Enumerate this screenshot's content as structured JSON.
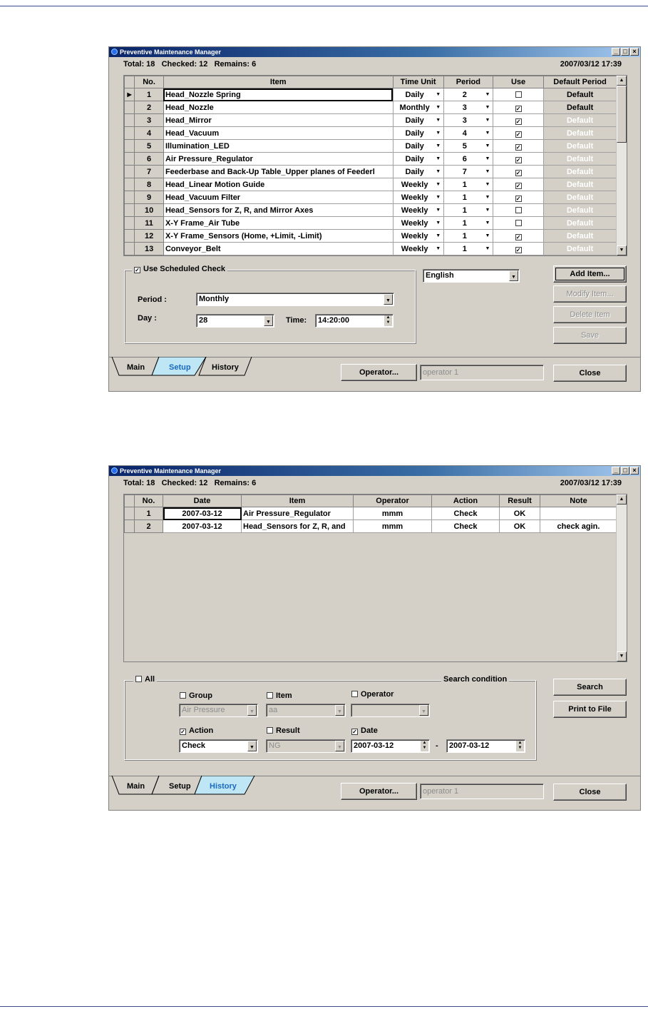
{
  "window_title": "Preventive Maintenance Manager",
  "setup": {
    "info": {
      "total": "Total: 18",
      "checked": "Checked: 12",
      "remains": "Remains: 6",
      "datetime": "2007/03/12 17:39"
    },
    "columns": [
      "No.",
      "Item",
      "Time Unit",
      "Period",
      "Use",
      "Default Period"
    ],
    "rows": [
      {
        "no": "1",
        "item": "Head_Nozzle Spring",
        "unit": "Daily",
        "period": "2",
        "use": false,
        "default": "Default",
        "default_enabled": true,
        "current": true
      },
      {
        "no": "2",
        "item": "Head_Nozzle",
        "unit": "Monthly",
        "period": "3",
        "use": true,
        "default": "Default",
        "default_enabled": true
      },
      {
        "no": "3",
        "item": "Head_Mirror",
        "unit": "Daily",
        "period": "3",
        "use": true,
        "default": "Default",
        "default_enabled": false
      },
      {
        "no": "4",
        "item": "Head_Vacuum",
        "unit": "Daily",
        "period": "4",
        "use": true,
        "default": "Default",
        "default_enabled": false
      },
      {
        "no": "5",
        "item": "Illumination_LED",
        "unit": "Daily",
        "period": "5",
        "use": true,
        "default": "Default",
        "default_enabled": false
      },
      {
        "no": "6",
        "item": "Air Pressure_Regulator",
        "unit": "Daily",
        "period": "6",
        "use": true,
        "default": "Default",
        "default_enabled": false
      },
      {
        "no": "7",
        "item": "Feederbase and Back-Up Table_Upper planes of Feederl",
        "unit": "Daily",
        "period": "7",
        "use": true,
        "default": "Default",
        "default_enabled": false
      },
      {
        "no": "8",
        "item": "Head_Linear Motion Guide",
        "unit": "Weekly",
        "period": "1",
        "use": true,
        "default": "Default",
        "default_enabled": false
      },
      {
        "no": "9",
        "item": "Head_Vacuum Filter",
        "unit": "Weekly",
        "period": "1",
        "use": true,
        "default": "Default",
        "default_enabled": false
      },
      {
        "no": "10",
        "item": "Head_Sensors for Z, R, and Mirror Axes",
        "unit": "Weekly",
        "period": "1",
        "use": false,
        "default": "Default",
        "default_enabled": false
      },
      {
        "no": "11",
        "item": "X-Y Frame_Air Tube",
        "unit": "Weekly",
        "period": "1",
        "use": false,
        "default": "Default",
        "default_enabled": false
      },
      {
        "no": "12",
        "item": "X-Y Frame_Sensors (Home, +Limit, -Limit)",
        "unit": "Weekly",
        "period": "1",
        "use": true,
        "default": "Default",
        "default_enabled": false
      },
      {
        "no": "13",
        "item": "Conveyor_Belt",
        "unit": "Weekly",
        "period": "1",
        "use": true,
        "default": "Default",
        "default_enabled": false
      }
    ],
    "schedule": {
      "label": "Use Scheduled Check",
      "checked": true,
      "period_label": "Period :",
      "period_value": "Monthly",
      "day_label": "Day :",
      "day_value": "28",
      "time_label": "Time:",
      "time_value": "14:20:00"
    },
    "language": "English",
    "buttons": {
      "add": "Add Item...",
      "modify": "Modify Item...",
      "delete": "Delete Item",
      "save": "Save"
    },
    "tabs": [
      "Main",
      "Setup",
      "History"
    ],
    "active_tab": "Setup",
    "operator_button": "Operator...",
    "operator_value": "operator 1",
    "close": "Close"
  },
  "history": {
    "info": {
      "total": "Total: 18",
      "checked": "Checked: 12",
      "remains": "Remains: 6",
      "datetime": "2007/03/12 17:39"
    },
    "columns": [
      "No.",
      "Date",
      "Item",
      "Operator",
      "Action",
      "Result",
      "Note"
    ],
    "rows": [
      {
        "no": "1",
        "date": "2007-03-12",
        "item": "Air Pressure_Regulator",
        "operator": "mmm",
        "action": "Check",
        "result": "OK",
        "note": ""
      },
      {
        "no": "2",
        "date": "2007-03-12",
        "item": "Head_Sensors for Z, R, and",
        "operator": "mmm",
        "action": "Check",
        "result": "OK",
        "note": "check agin."
      }
    ],
    "search": {
      "title": "Search condition",
      "all_label": "All",
      "all_checked": false,
      "group_label": "Group",
      "group_checked": false,
      "group_value": "Air Pressure",
      "item_label": "Item",
      "item_checked": false,
      "item_value": "aa",
      "operator_label": "Operator",
      "operator_checked": false,
      "operator_value": "",
      "action_label": "Action",
      "action_checked": true,
      "action_value": "Check",
      "result_label": "Result",
      "result_checked": false,
      "result_value": "NG",
      "date_label": "Date",
      "date_checked": true,
      "date_from": "2007-03-12",
      "date_sep": "-",
      "date_to": "2007-03-12"
    },
    "buttons": {
      "search": "Search",
      "print": "Print to File"
    },
    "tabs": [
      "Main",
      "Setup",
      "History"
    ],
    "active_tab": "History",
    "operator_button": "Operator...",
    "operator_value": "operator 1",
    "close": "Close"
  },
  "icons": {
    "check": "✓",
    "arrow_down": "▼",
    "arrow_up": "▲",
    "row_pointer": "▶"
  },
  "colors": {
    "title_bar": "#0a246a",
    "active_tab": "#1a6ac0",
    "window_face": "#d4d0c8"
  }
}
